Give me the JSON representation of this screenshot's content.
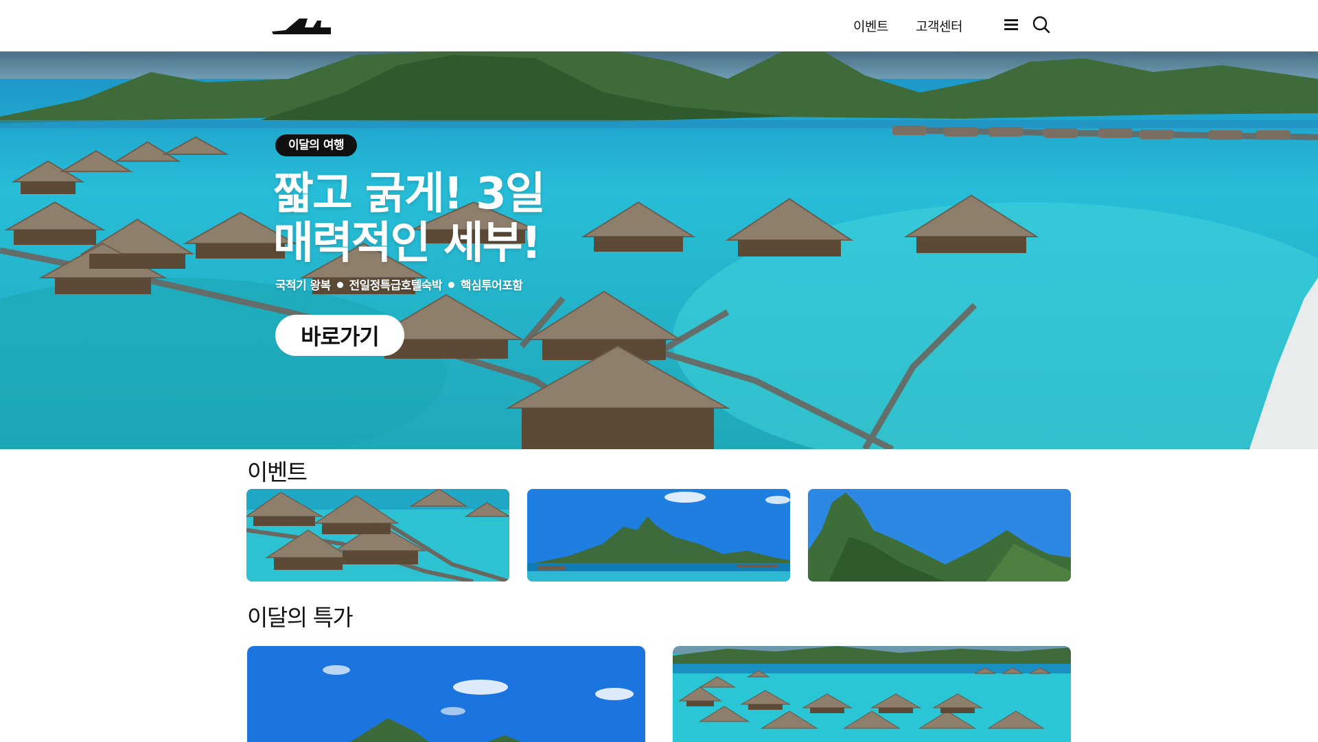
{
  "header": {
    "logo_name": "airplane-logo",
    "nav": [
      {
        "label": "이벤트"
      },
      {
        "label": "고객센터"
      }
    ],
    "menu_icon": "hamburger-menu-icon",
    "search_icon": "search-icon"
  },
  "hero": {
    "badge": "이달의 여행",
    "title_line1": "짧고 굵게! 3일",
    "title_line2": "매력적인 세부!",
    "features": [
      "국적기 왕복",
      "전일정특급호텔숙박",
      "핵심투어포함"
    ],
    "cta_label": "바로가기"
  },
  "events": {
    "title": "이벤트",
    "cards": [
      {
        "image": "overwater-bungalows"
      },
      {
        "image": "island-mountain-sea"
      },
      {
        "image": "mountain-peak"
      }
    ]
  },
  "deals": {
    "title": "이달의 특가",
    "cards": [
      {
        "image": "island-sky"
      },
      {
        "image": "bungalow-lagoon"
      }
    ]
  },
  "colors": {
    "lagoon": "#29c4d6",
    "deep_water": "#0a8fb5",
    "sky": "#1e7fe0",
    "mountain": "#3d6b3a",
    "thatch": "#8a7a66"
  }
}
